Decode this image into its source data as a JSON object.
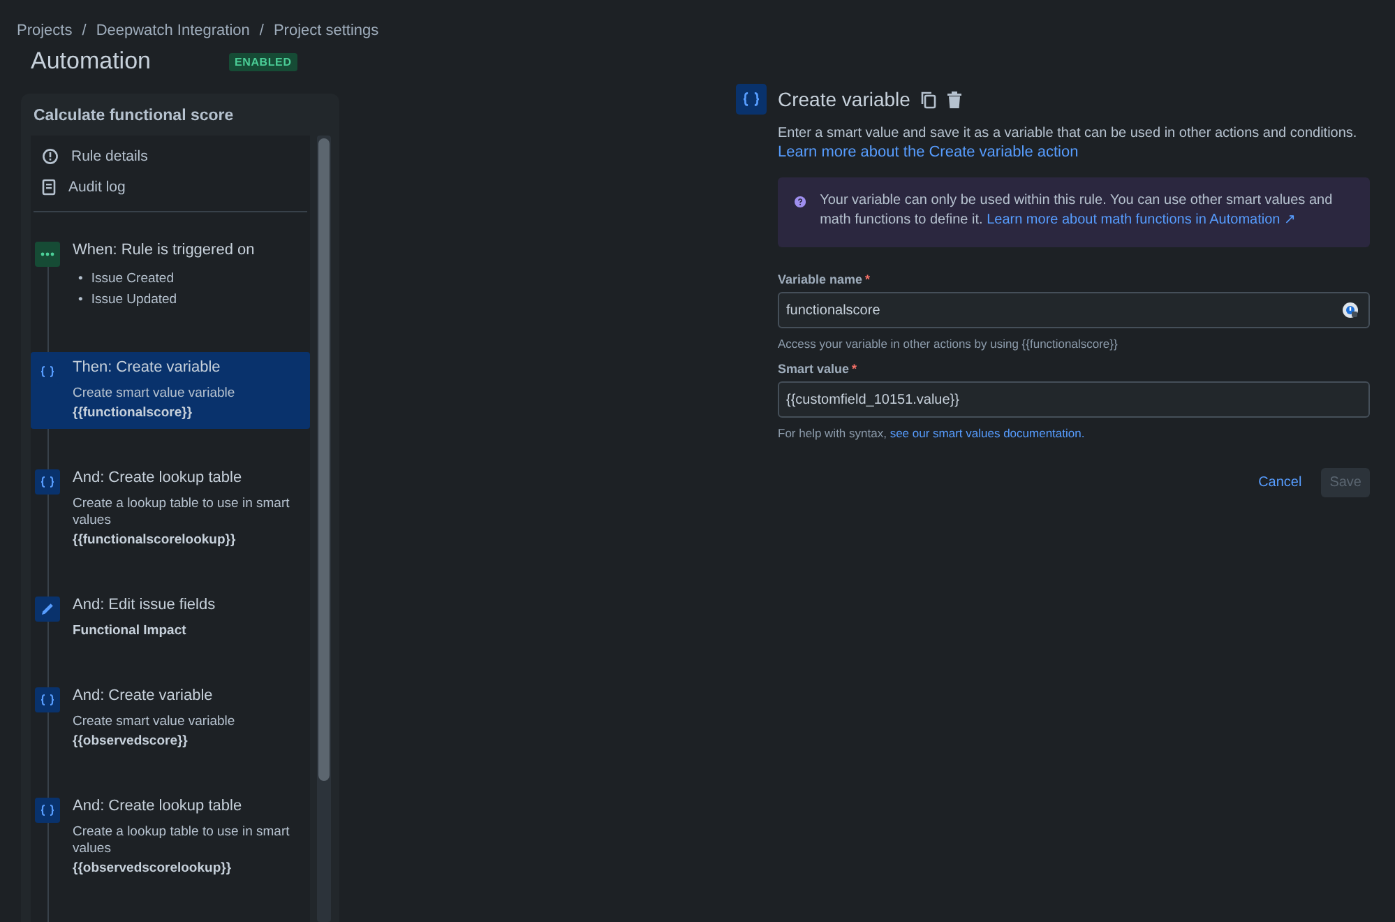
{
  "breadcrumbs": [
    "Projects",
    "Deepwatch Integration",
    "Project settings"
  ],
  "breadcrumb_separator": "/",
  "bullet": "•",
  "page": {
    "title": "Automation",
    "status": "ENABLED"
  },
  "rule": {
    "name": "Calculate functional score",
    "nav": [
      {
        "kind": "info",
        "label": "Rule details"
      },
      {
        "kind": "log",
        "label": "Audit log"
      }
    ],
    "steps": [
      {
        "kind": "trigger",
        "title": "When: Rule is triggered on",
        "items": [
          "Issue Created",
          "Issue Updated"
        ],
        "selected": false
      },
      {
        "kind": "variable",
        "title": "Then: Create variable",
        "description": "Create smart value variable",
        "value": "{{functionalscore}}",
        "selected": true
      },
      {
        "kind": "variable",
        "title": "And: Create lookup table",
        "description": "Create a lookup table to use in smart values",
        "value": "{{functionalscorelookup}}",
        "selected": false
      },
      {
        "kind": "edit",
        "title": "And: Edit issue fields",
        "value": "Functional Impact",
        "selected": false
      },
      {
        "kind": "variable",
        "title": "And: Create variable",
        "description": "Create smart value variable",
        "value": "{{observedscore}}",
        "selected": false
      },
      {
        "kind": "variable",
        "title": "And: Create lookup table",
        "description": "Create a lookup table to use in smart values",
        "value": "{{observedscorelookup}}",
        "selected": false
      }
    ]
  },
  "detail": {
    "title": "Create variable",
    "description": "Enter a smart value and save it as a variable that can be used in other actions and conditions.",
    "learn_link": "Learn more about the Create variable action",
    "info": {
      "text": "Your variable can only be used within this rule. You can use other smart values and math functions to define it.",
      "link": "Learn more about math functions in Automation ↗"
    },
    "fields": [
      {
        "label": "Variable name",
        "required_mark": "*",
        "value": "functionalscore",
        "helper": "Access your variable in other actions by using {{functionalscore}}",
        "has_icon": true
      },
      {
        "label": "Smart value",
        "required_mark": "*",
        "value": "{{customfield_10151.value}}",
        "helper": "For help with syntax,",
        "helper_link": "see our smart values documentation.",
        "has_icon": false
      }
    ],
    "buttons": [
      {
        "kind": "link",
        "label": "Cancel",
        "disabled": false
      },
      {
        "kind": "primary",
        "label": "Save",
        "disabled": true
      }
    ]
  }
}
